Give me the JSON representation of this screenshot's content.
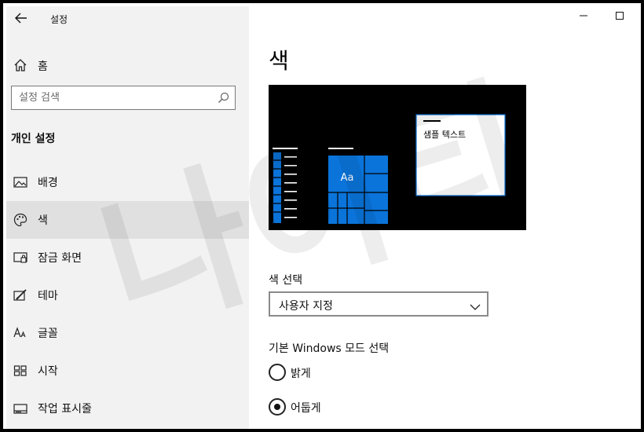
{
  "window": {
    "title": "설정",
    "minimize_icon": "minimize-icon",
    "maximize_icon": "maximize-icon"
  },
  "sidebar": {
    "back_icon": "back-arrow-icon",
    "home": {
      "label": "홈",
      "icon": "home-icon"
    },
    "search": {
      "placeholder": "설정 검색",
      "icon": "search-icon"
    },
    "section_title": "개인 설정",
    "items": [
      {
        "label": "배경",
        "icon": "image-icon",
        "selected": false
      },
      {
        "label": "색",
        "icon": "palette-icon",
        "selected": true
      },
      {
        "label": "잠금 화면",
        "icon": "lock-screen-icon",
        "selected": false
      },
      {
        "label": "테마",
        "icon": "theme-brush-icon",
        "selected": false
      },
      {
        "label": "글꼴",
        "icon": "font-icon",
        "selected": false
      },
      {
        "label": "시작",
        "icon": "start-grid-icon",
        "selected": false
      },
      {
        "label": "작업 표시줄",
        "icon": "taskbar-icon",
        "selected": false
      }
    ]
  },
  "main": {
    "title": "색",
    "preview": {
      "tile_text": "Aa",
      "sample_text": "샘플 텍스트",
      "accent_color": "#0a74da",
      "background_color": "#000000"
    },
    "color_select": {
      "label": "색 선택",
      "value": "사용자 지정"
    },
    "windows_mode": {
      "label": "기본 Windows 모드 선택",
      "options": [
        {
          "label": "밝게",
          "checked": false
        },
        {
          "label": "어둡게",
          "checked": true
        }
      ]
    }
  },
  "watermark": {
    "text": "나이티"
  }
}
